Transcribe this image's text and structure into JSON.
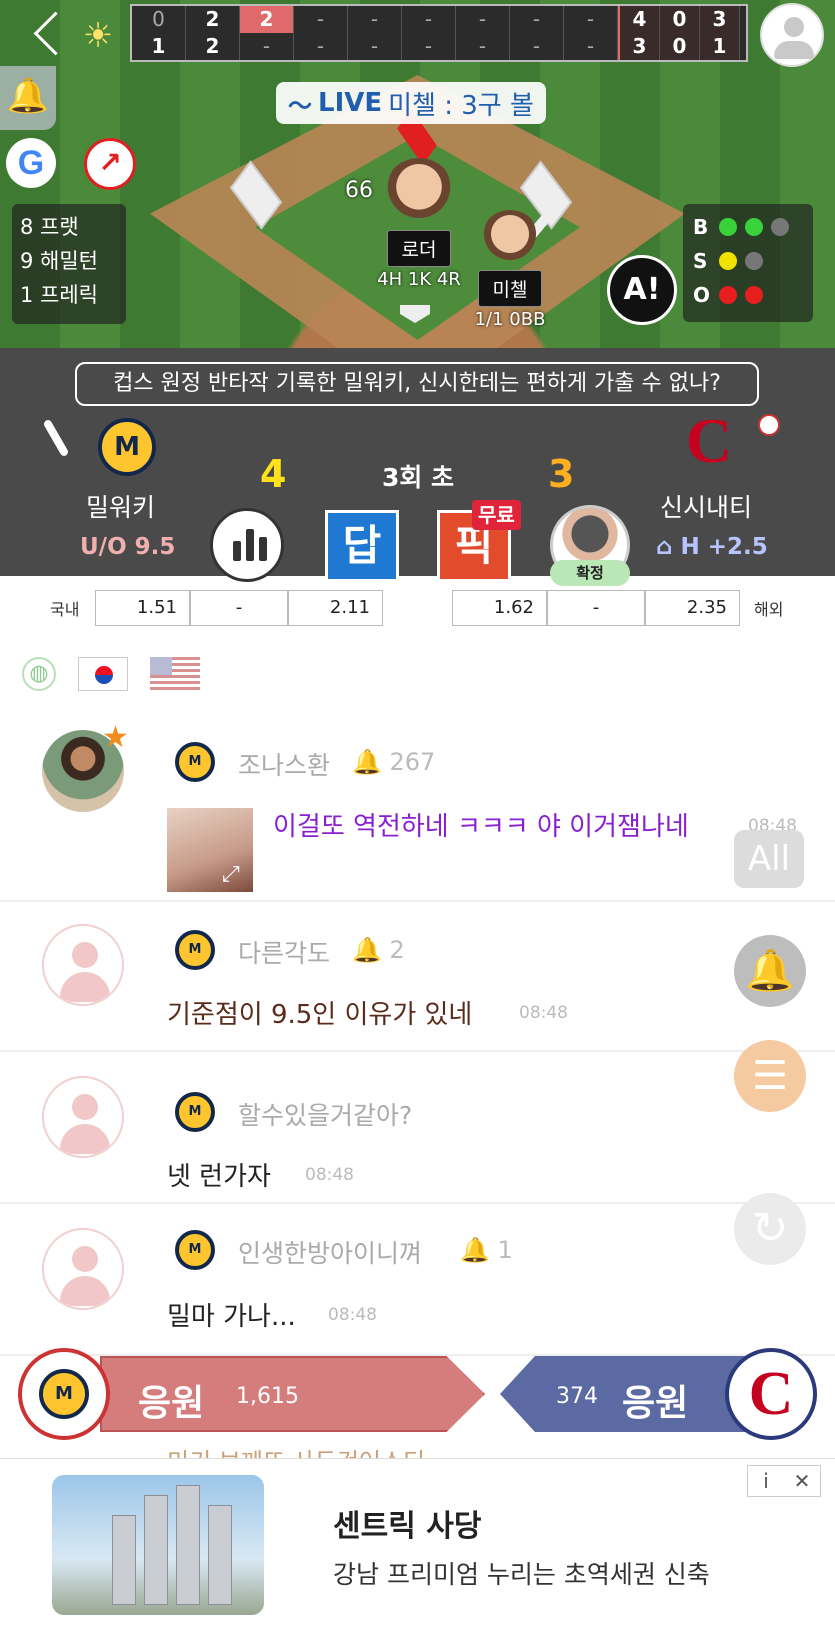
{
  "scoreboard": {
    "away": [
      "0",
      "2",
      "2",
      "-",
      "-",
      "-",
      "-",
      "-",
      "-"
    ],
    "home": [
      "1",
      "2",
      "-",
      "-",
      "-",
      "-",
      "-",
      "-",
      "-"
    ],
    "away_totals": [
      "4",
      "0",
      "3"
    ],
    "home_totals": [
      "3",
      "0",
      "1"
    ]
  },
  "live": {
    "tag": "LIVE",
    "message": "미첼 : 3구 볼"
  },
  "lineup": [
    "8 프랫",
    "9 해밀턴",
    "1 프레릭"
  ],
  "pitch_count": "66",
  "pitcher": {
    "name": "로더",
    "stat": "4H 1K 4R"
  },
  "batter": {
    "name": "미첼",
    "stat": "1/1 0BB"
  },
  "ai_label": "A!",
  "count": {
    "b_label": "B",
    "s_label": "S",
    "o_label": "O",
    "balls": 2,
    "strikes": 1,
    "outs": 2
  },
  "headline": "컵스 원정 반타작 기록한 밀워키, 신시한테는 편하게 가출 수 없나?",
  "inning": "3회 초",
  "away_team": {
    "name": "밀워키",
    "sub": "U/O 9.5",
    "score": "4",
    "logo": "M"
  },
  "home_team": {
    "name": "신시내티",
    "sub": "H +2.5",
    "score": "3",
    "logo": "C",
    "home_icon": "⌂"
  },
  "buttons": {
    "dap": "답",
    "pick": "픽",
    "free": "무료",
    "confirm": "확정"
  },
  "odds": {
    "domestic_label": "국내",
    "foreign_label": "해외",
    "left": [
      "1.51",
      "-",
      "2.11"
    ],
    "right": [
      "1.62",
      "-",
      "2.35"
    ]
  },
  "chat": [
    {
      "user": "조나스환",
      "bell": "267",
      "message": "이걸또 역전하네 ㅋㅋㅋ 야 이거잼나네",
      "time": "08:48"
    },
    {
      "user": "다른각도",
      "bell": "2",
      "message": "기준점이 9.5인 이유가 있네",
      "time": "08:48"
    },
    {
      "user": "할수있을거같아?",
      "bell": "",
      "message": "넷 런가자",
      "time": "08:48"
    },
    {
      "user": "인생한방아이니껴",
      "bell": "1",
      "message": "밀마 가나...",
      "time": "08:48"
    }
  ],
  "fab": {
    "all": "All"
  },
  "cheer": {
    "left_label": "응원",
    "left_count": "1,615",
    "right_label": "응원",
    "right_count": "374"
  },
  "peek": "미키 보께뜨 사두건어스티",
  "ad": {
    "title": "센트릭 사당",
    "description": "강남 프리미엄 누리는 초역세권 신축",
    "info": "i",
    "close": "✕"
  },
  "colors": {
    "away": "#12284b",
    "home": "#c6011f",
    "accent": "#e06a6a"
  }
}
